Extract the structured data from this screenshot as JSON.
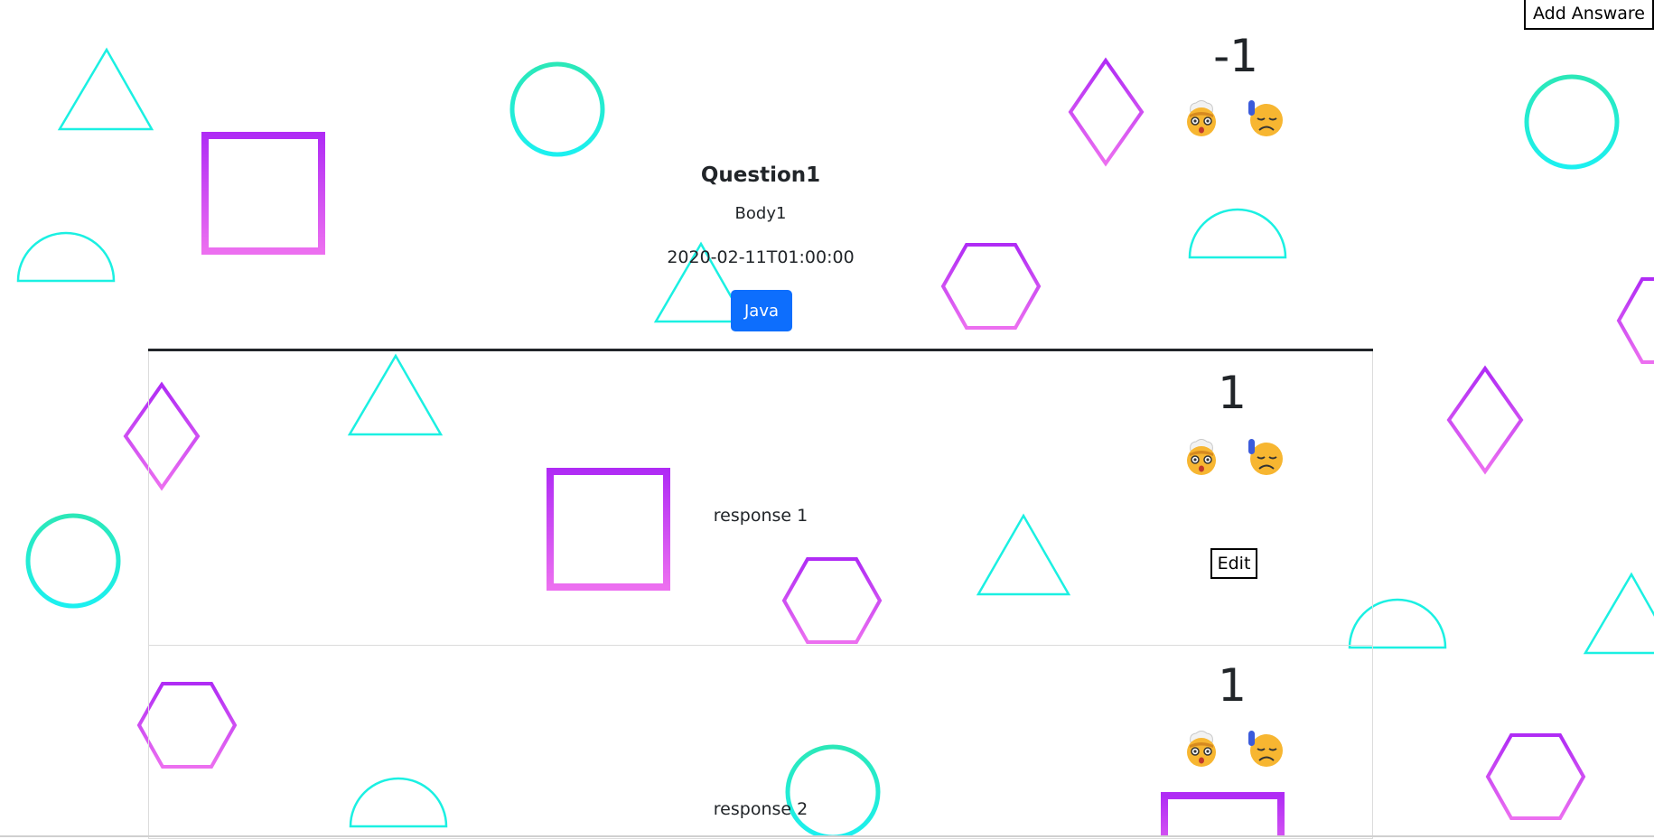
{
  "header": {
    "add_answer_label": "Add Answare"
  },
  "question": {
    "score": "-1",
    "title": "Question1",
    "body": "Body1",
    "date": "2020-02-11T01:00:00",
    "tag": "Java"
  },
  "answers": [
    {
      "score": "1",
      "text": "response 1",
      "edit_label": "Edit"
    },
    {
      "score": "1",
      "text": "response 2"
    }
  ],
  "icons": {
    "upvote": "exploding-head-icon",
    "downvote": "sad-face-icon"
  },
  "colors": {
    "accent": "#0d6efd",
    "shape_cyan": "#1bf0e2",
    "shape_purple": "#b02cf5",
    "shape_pink": "#ec6ff0"
  }
}
